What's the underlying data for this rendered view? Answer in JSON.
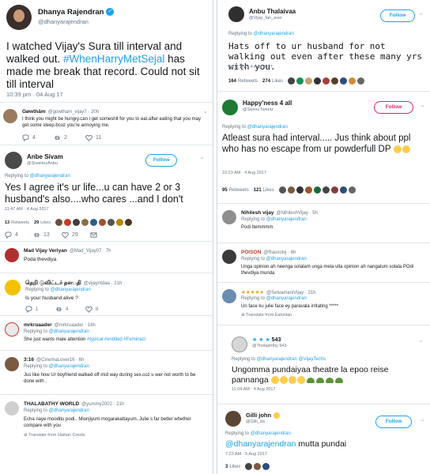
{
  "colors": {
    "link": "#1da1f2",
    "muted": "#657786",
    "text": "#14171a",
    "like": "#e0245e"
  },
  "left": {
    "t1": {
      "name": "Dhanya Rajendran",
      "handle": "@dhanyarajendran",
      "text_a": "I watched Vijay's Sura till interval and walked out. ",
      "hashtag": "#WhenHarryMetSejal",
      "text_b": " has made me break that record. Could not sit till interval",
      "time": "10:39 pm · 04 Aug 17"
    },
    "r1": {
      "name": "Gøwthäm",
      "handle": "@gowtham_vijay7 · 20h",
      "text": "I think you might be hungry.can i get someshit for you to eat.after eating that you may get some sleep.bcoz you're annoying me.",
      "replies": "4",
      "retweets": "2",
      "likes": "11"
    },
    "r2": {
      "name": "Anbe Sivam",
      "handle": "@SivaHeyAnbu",
      "follow": "Follow",
      "replying_prefix": "Replying to ",
      "replying_to": "@dhanyarajendran",
      "text": "Yes I agree it's ur life...u can have 2 or 3 husband's also....who cares ...and I don't",
      "time": "11:47 AM · 4 Aug 2017",
      "stats_retweets": "13",
      "retweets_label": "Retweets",
      "stats_likes": "29",
      "likes_label": "Likes",
      "replies": "4",
      "retweets": "13",
      "likes": "29"
    },
    "r3": {
      "name": "Mad Vijay Veriyan",
      "handle": "@Mad_Vijay07 · 7h",
      "text": "Poda thevdiya"
    },
    "r4": {
      "name": "தெறி டுவிட்டர் தளபதி",
      "handle": "@vijayntdaa · 21h",
      "replying_prefix": "Replying to ",
      "replying_to": "@dhanyarajendran",
      "text": "Is your husband alive ?",
      "replies": "1",
      "retweets": "4",
      "likes": "8"
    },
    "r5": {
      "name": "mrkruaader",
      "handle": "@mrkruaader · 16h",
      "replying_prefix": "Replying to ",
      "replying_to": "@dhanyarajendran",
      "text_a": "She just wants male attention ",
      "hashtags": "#typical #entitled #Feminazi"
    },
    "r6": {
      "name": "3:16",
      "handle": "@CinemaLover16 · 6h",
      "replying_prefix": "Replying to ",
      "replying_to": "@dhanyarajendran",
      "text": "Jus like how Ur boyfriend walked off mid way during sex.coz u wer not worth to be done with ."
    },
    "r7": {
      "name": "THALABATHY WORLD",
      "handle": "@yummy2002 · 21h",
      "replying_prefix": "Replying to ",
      "replying_to": "@dhanyarajendran",
      "text": "Echa naye mooditu podi.. Mionjiyum mogarakattayum..Julie s far better whether compare with you",
      "translate": "Translate from Haitian Creole"
    }
  },
  "right": {
    "t1": {
      "name": "Anbu Thalaivaa",
      "handle": "@Vijay_fan_aver",
      "follow": "Follow",
      "replying_prefix": "Replying to ",
      "replying_to": "@dhanyarajendran",
      "text": "Hats off to ur husband for not walking out even after these many yrs with you.",
      "time": "10:11 AM · 4 Aug 2017",
      "stats_retweets": "164",
      "retweets_label": "Retweets",
      "stats_likes": "274",
      "likes_label": "Likes"
    },
    "t2": {
      "name": "Happy'ness 4 all",
      "handle": "@SeenuTweetz",
      "follow": "Follow",
      "replying_prefix": "Replying to ",
      "replying_to": "@dhanyarajendran",
      "text": "Atleast sura had interval..... Jus think about ppl who has no escape from ur powderfull DP",
      "time": "10:23 AM · 4 Aug 2017",
      "stats_retweets": "95",
      "retweets_label": "Retweets",
      "stats_likes": "121",
      "likes_label": "Likes"
    },
    "r1": {
      "name": "Nihilesh vijay",
      "handle": "@NihileshVijay · 5h",
      "replying_prefix": "Replying to ",
      "replying_to": "@dhanyarajendran",
      "text": "Podi Itemmmm"
    },
    "r2": {
      "name": "POISON",
      "handle": "@Rasoolvj · 6h",
      "replying_prefix": "Replying to ",
      "replying_to": "@dhanyarajendran",
      "text": "Unga opinion ah neenga solalam unga mela ulla opinion ah nangalum solala POdi thevdiya munda"
    },
    "r3": {
      "name": "★★★★★",
      "handle": "@SelvamaniVijay · 21h",
      "replying_prefix": "Replying to ",
      "replying_to": "@dhanyarajendran",
      "text": "Un face ku julie face ey paravala irritating *****",
      "translate": "Translate from Estonian"
    },
    "t3": {
      "name": "543",
      "handle": "@Tholaphthy 543",
      "replying_prefix": "Replying to ",
      "replying_to": "@dhanyarajendran @VijayTechs",
      "text": "Ungomma pundaiyaa theatre la epoo reise pannanga",
      "time": "11:04 AM · 4 Aug 2017"
    },
    "t4": {
      "name": "Gilli john",
      "handle": "@Gilli_da",
      "follow": "Follow",
      "replying_prefix": "Replying to ",
      "replying_to": "@dhanyarajendran",
      "mention": "@dhanyarajendran",
      "text": " mutta pundai",
      "time": "7:23 AM · 5 Aug 2017",
      "stats_likes": "3",
      "likes_label": "Likes"
    }
  }
}
